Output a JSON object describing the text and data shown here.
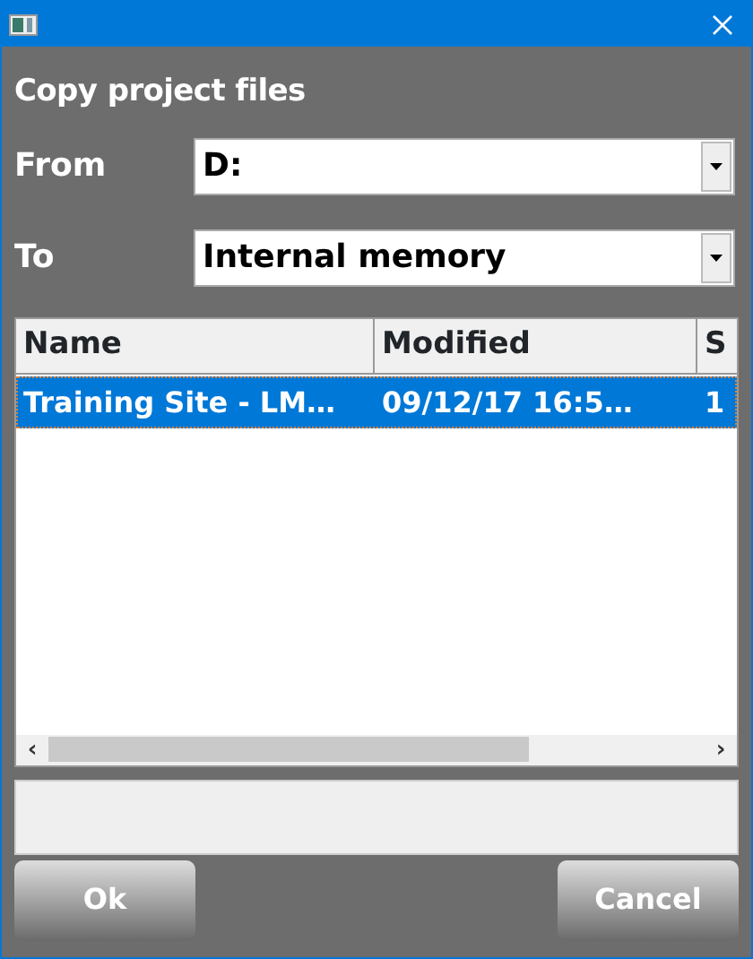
{
  "heading": "Copy project files",
  "fields": [
    {
      "label": "From",
      "value": "D:"
    },
    {
      "label": "To",
      "value": "Internal memory"
    }
  ],
  "table": {
    "columns": [
      "Name",
      "Modified",
      "S"
    ],
    "rows": [
      {
        "cells": [
          "Training Site - LM…",
          "09/12/17 16:5…",
          "1"
        ],
        "selected": true
      }
    ]
  },
  "scrollbar_arrows": [
    "‹",
    "›"
  ],
  "buttons": [
    "Ok",
    "Cancel"
  ]
}
